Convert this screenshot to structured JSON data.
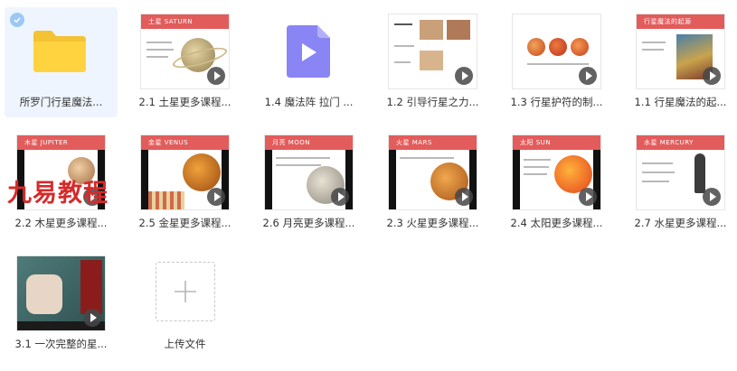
{
  "colors": {
    "selected_bg": "#eef5fe",
    "check_blue": "#9cc8f5",
    "folder_yellow": "#ffd340",
    "video_icon_purple": "#8a85f5",
    "watermark_red": "#d62a2a"
  },
  "files": [
    {
      "name": "所罗门行星魔法...",
      "kind": "folder",
      "selected": true
    },
    {
      "name": "2.1 土星更多课程...",
      "kind": "video",
      "band_text": "土星 SATURN"
    },
    {
      "name": "1.4 魔法阵 拉门 ...",
      "kind": "video-file-icon"
    },
    {
      "name": "1.2 引导行星之力...",
      "kind": "video"
    },
    {
      "name": "1.3 行星护符的制...",
      "kind": "video"
    },
    {
      "name": "1.1 行星魔法的起...",
      "kind": "video",
      "band_text": "行星魔法的起源"
    },
    {
      "name": "2.2 木星更多课程...",
      "kind": "video",
      "band_text": "木星 JUPITER"
    },
    {
      "name": "2.5 金星更多课程...",
      "kind": "video",
      "band_text": "金星 VENUS"
    },
    {
      "name": "2.6 月亮更多课程...",
      "kind": "video",
      "band_text": "月亮 MOON"
    },
    {
      "name": "2.3 火星更多课程...",
      "kind": "video",
      "band_text": "火星 MARS"
    },
    {
      "name": "2.4 太阳更多课程...",
      "kind": "video",
      "band_text": "太阳 SUN"
    },
    {
      "name": "2.7 水星更多课程...",
      "kind": "video",
      "band_text": "水星 MERCURY"
    },
    {
      "name": "3.1 一次完整的星...",
      "kind": "video"
    }
  ],
  "upload": {
    "label": "上传文件"
  },
  "watermark": "九易教程"
}
